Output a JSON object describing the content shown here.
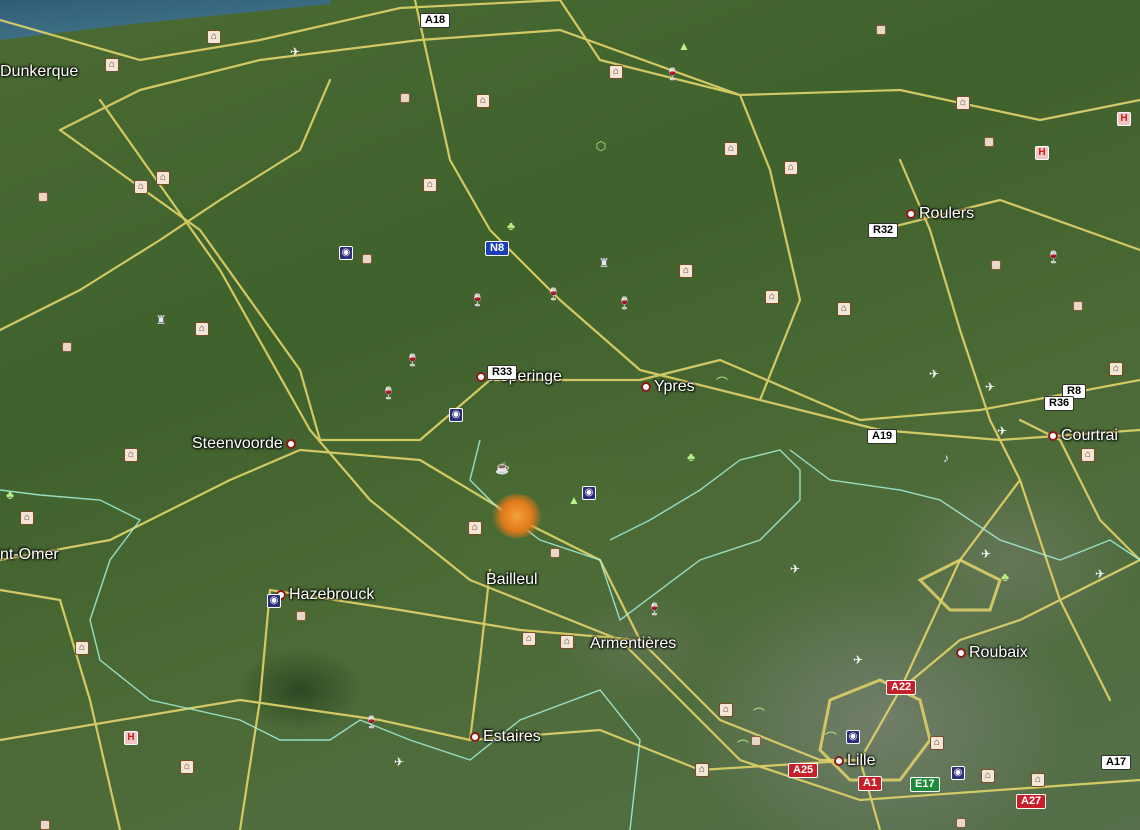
{
  "map": {
    "cities": [
      {
        "id": "dunkerque",
        "name": "Dunkerque",
        "marker": false
      },
      {
        "id": "poperinge",
        "name": "Poperinge",
        "marker": true
      },
      {
        "id": "ypres",
        "name": "Ypres",
        "marker": true
      },
      {
        "id": "roulers",
        "name": "Roulers",
        "marker": true
      },
      {
        "id": "steenvoorde",
        "name": "Steenvoorde",
        "marker": true
      },
      {
        "id": "saint-omer",
        "name": "nt-Omer",
        "marker": false
      },
      {
        "id": "hazebrouck",
        "name": "Hazebrouck",
        "marker": true
      },
      {
        "id": "bailleul",
        "name": "Bailleul",
        "marker": true
      },
      {
        "id": "armentieres",
        "name": "Armentières",
        "marker": true
      },
      {
        "id": "courtrai",
        "name": "Courtrai",
        "marker": true
      },
      {
        "id": "roubaix",
        "name": "Roubaix",
        "marker": true
      },
      {
        "id": "estaires",
        "name": "Estaires",
        "marker": true
      },
      {
        "id": "lille",
        "name": "Lille",
        "marker": true
      }
    ],
    "road_shields": [
      {
        "id": "a18",
        "label": "A18",
        "style": "w"
      },
      {
        "id": "n8",
        "label": "N8",
        "style": "b"
      },
      {
        "id": "r32",
        "label": "R32",
        "style": "w"
      },
      {
        "id": "r33",
        "label": "R33",
        "style": "w"
      },
      {
        "id": "a19",
        "label": "A19",
        "style": "w"
      },
      {
        "id": "r8",
        "label": "R8",
        "style": "w"
      },
      {
        "id": "r36",
        "label": "R36",
        "style": "w"
      },
      {
        "id": "a22",
        "label": "A22",
        "style": "r"
      },
      {
        "id": "a25",
        "label": "A25",
        "style": "r"
      },
      {
        "id": "a1",
        "label": "A1",
        "style": "r"
      },
      {
        "id": "a17",
        "label": "A17",
        "style": "w"
      },
      {
        "id": "a27",
        "label": "A27",
        "style": "r"
      },
      {
        "id": "e17",
        "label": "E17",
        "style": "g"
      }
    ],
    "colors": {
      "road": "#e6d76a",
      "border": "#9ff0d8",
      "incident": "#e07a1a"
    }
  }
}
